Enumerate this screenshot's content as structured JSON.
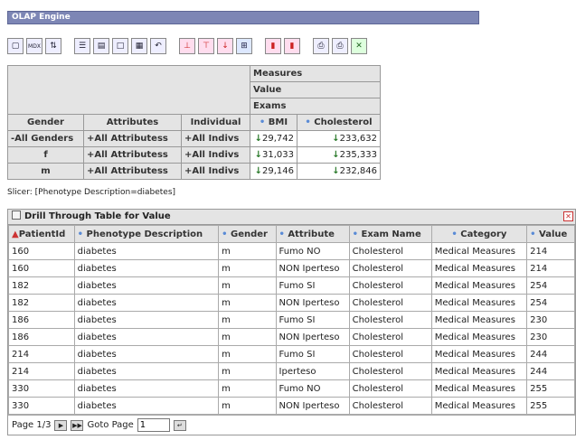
{
  "window": {
    "title": "OLAP Engine"
  },
  "pivot": {
    "measures_label": "Measures",
    "value_label": "Value",
    "exams_label": "Exams",
    "col_gender": "Gender",
    "col_attributes": "Attributes",
    "col_individual": "Individual",
    "col_bmi": "BMI",
    "col_cholesterol": "Cholesterol",
    "rows": [
      {
        "gender": "-All Genders",
        "attr": "+All Attributess",
        "indiv": "+All Indivs",
        "bmi": "29,742",
        "chol": "233,632"
      },
      {
        "gender": "f",
        "attr": "+All Attributess",
        "indiv": "+All Indivs",
        "bmi": "31,033",
        "chol": "235,333"
      },
      {
        "gender": "m",
        "attr": "+All Attributess",
        "indiv": "+All Indivs",
        "bmi": "29,146",
        "chol": "232,846"
      }
    ]
  },
  "slicer": "Slicer: [Phenotype Description=diabetes]",
  "drill": {
    "title": "Drill Through Table for Value",
    "headers": [
      "PatientId",
      "Phenotype Description",
      "Gender",
      "Attribute",
      "Exam Name",
      "Category",
      "Value"
    ],
    "rows": [
      [
        "160",
        "diabetes",
        "m",
        "Fumo NO",
        "Cholesterol",
        "Medical Measures",
        "214"
      ],
      [
        "160",
        "diabetes",
        "m",
        "NON Iperteso",
        "Cholesterol",
        "Medical Measures",
        "214"
      ],
      [
        "182",
        "diabetes",
        "m",
        "Fumo SI",
        "Cholesterol",
        "Medical Measures",
        "254"
      ],
      [
        "182",
        "diabetes",
        "m",
        "NON Iperteso",
        "Cholesterol",
        "Medical Measures",
        "254"
      ],
      [
        "186",
        "diabetes",
        "m",
        "Fumo SI",
        "Cholesterol",
        "Medical Measures",
        "230"
      ],
      [
        "186",
        "diabetes",
        "m",
        "NON Iperteso",
        "Cholesterol",
        "Medical Measures",
        "230"
      ],
      [
        "214",
        "diabetes",
        "m",
        "Fumo SI",
        "Cholesterol",
        "Medical Measures",
        "244"
      ],
      [
        "214",
        "diabetes",
        "m",
        "Iperteso",
        "Cholesterol",
        "Medical Measures",
        "244"
      ],
      [
        "330",
        "diabetes",
        "m",
        "Fumo NO",
        "Cholesterol",
        "Medical Measures",
        "255"
      ],
      [
        "330",
        "diabetes",
        "m",
        "NON Iperteso",
        "Cholesterol",
        "Medical Measures",
        "255"
      ]
    ],
    "pager_page": "Page 1/3",
    "goto_label": "Goto Page",
    "goto_value": "1"
  }
}
